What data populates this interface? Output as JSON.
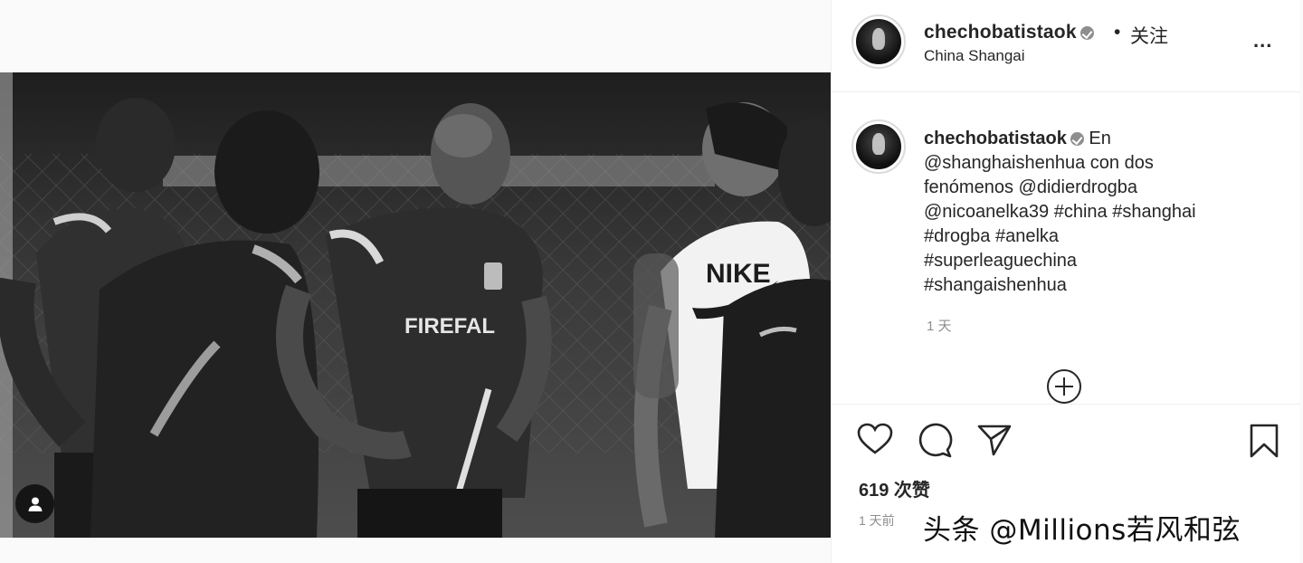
{
  "post": {
    "header": {
      "username": "chechobatistaok",
      "separator": "•",
      "follow_label": "关注",
      "location": "China Shangai",
      "more_label": "..."
    },
    "caption": {
      "username": "chechobatistaok",
      "lines": [
        "En",
        "@shanghaishenhua con dos",
        "fenómenos @didierdrogba",
        "@nicoanelka39 #china #shanghai",
        "#drogba #anelka",
        "#superleaguechina",
        "#shangaishenhua"
      ],
      "time": "1 天"
    },
    "photo": {
      "jersey_text": "FIREFAL",
      "shirt_text": "NIKE"
    },
    "likes_label": "619 次赞",
    "date_label": "1 天前"
  },
  "icons": {
    "like": "heart-icon",
    "comment": "comment-icon",
    "share": "paper-plane-icon",
    "save": "bookmark-icon",
    "tags": "user-tag-icon",
    "load_more": "plus-circle-icon"
  },
  "watermark": "头条 @Millions若风和弦"
}
